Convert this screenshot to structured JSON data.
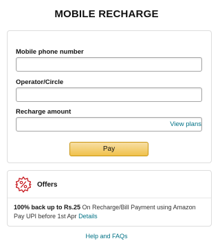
{
  "page": {
    "title": "MOBILE RECHARGE"
  },
  "form": {
    "phone_label": "Mobile phone number",
    "phone_value": "",
    "operator_label": "Operator/Circle",
    "operator_value": "",
    "amount_label": "Recharge amount",
    "amount_value": "",
    "view_plans_label": "View plans",
    "pay_label": "Pay"
  },
  "offers": {
    "title": "Offers",
    "icon": "percent-badge-icon",
    "highlight": "100% back up to Rs.25",
    "description": " On Recharge/Bill Payment using Amazon Pay UPI before 1st Apr ",
    "details_label": "Details"
  },
  "footer": {
    "help_label": "Help and FAQs"
  },
  "colors": {
    "link": "#007185",
    "pay_button": "#f0c14b",
    "offer_icon": "#c7161c"
  }
}
